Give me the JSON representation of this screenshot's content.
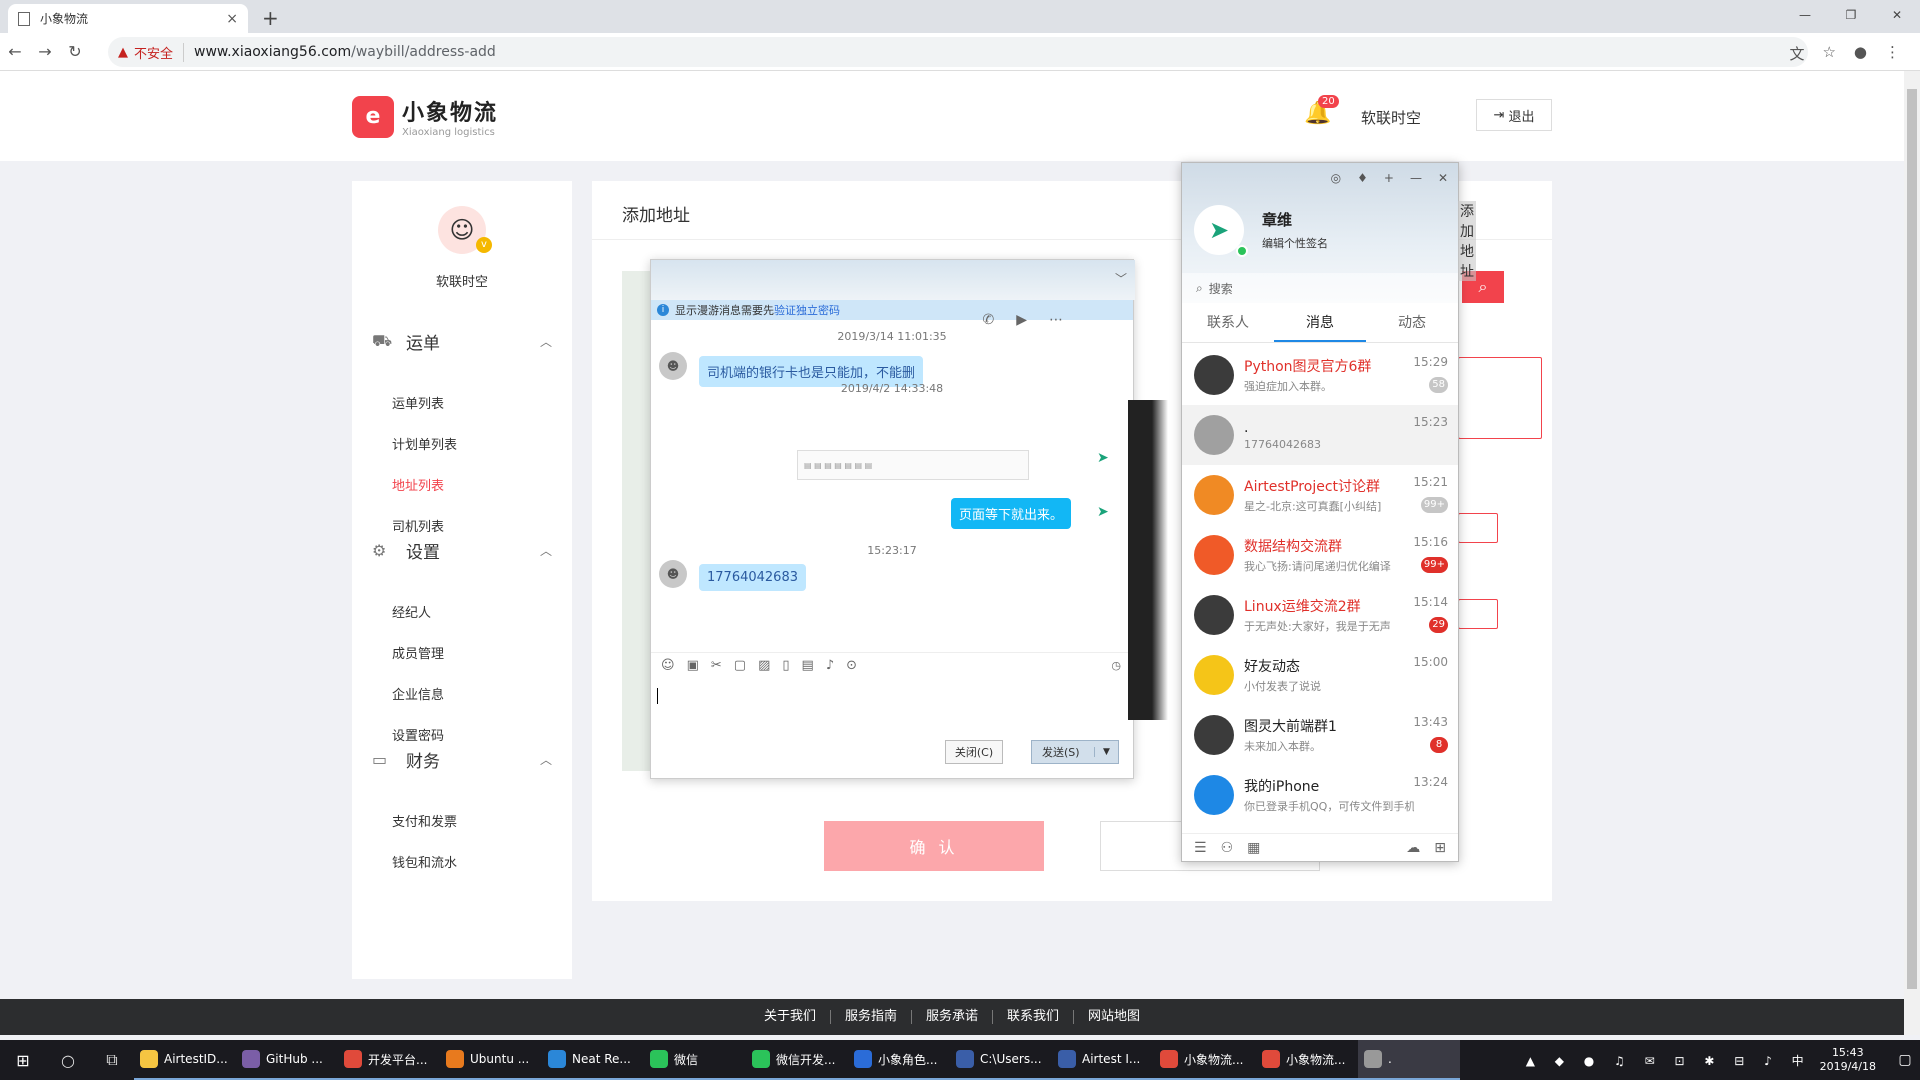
{
  "browser": {
    "tab_title": "小象物流",
    "tab_close": "×",
    "new_tab": "+",
    "insecure_label": "不安全",
    "url_host": "www.xiaoxiang56.com",
    "url_path": "/waybill/address-add"
  },
  "header": {
    "logo_cn": "小象物流",
    "logo_en": "Xiaoxiang logistics",
    "notify_count": "20",
    "user_name": "软联时空",
    "logout_label": "退出"
  },
  "sidebar": {
    "user_name": "软联时空",
    "sections": [
      {
        "title": "运单",
        "items": [
          "运单列表",
          "计划单列表",
          "地址列表",
          "司机列表"
        ]
      },
      {
        "title": "设置",
        "items": [
          "经纪人",
          "成员管理",
          "企业信息",
          "设置密码"
        ]
      },
      {
        "title": "财务",
        "items": [
          "支付和发票",
          "钱包和流水"
        ]
      }
    ],
    "active_item": "地址列表"
  },
  "main": {
    "title": "添加地址",
    "confirm_label": "确 认"
  },
  "chat": {
    "notice_text": "显示漫游消息需要先",
    "notice_link": "验证独立密码",
    "messages": [
      {
        "time": "2019/3/14 11:01:35",
        "text": "司机端的银行卡也是只能加，不能删",
        "dir": "in"
      },
      {
        "time": "2019/4/2 14:33:48",
        "text": "页面等下就出来。",
        "dir": "out"
      },
      {
        "time": "15:23:17",
        "text": "17764042683",
        "dir": "in"
      }
    ],
    "close_label": "关闭(C)",
    "send_label": "发送(S)"
  },
  "qq": {
    "name": "章维",
    "signature": "编辑个性签名",
    "overlay_text": "添加地址",
    "search_placeholder": "搜索",
    "tabs": [
      "联系人",
      "消息",
      "动态"
    ],
    "active_tab": "消息",
    "conversations": [
      {
        "name": "Python图灵官方6群",
        "sub": "强迫症加入本群。",
        "time": "15:29",
        "badge": "58",
        "red": true,
        "badge_color": "#c6c6c6",
        "avatar_color": "#3b3b3b"
      },
      {
        "name": ".",
        "sub": "17764042683",
        "time": "15:23",
        "badge": "",
        "red": false,
        "badge_color": "",
        "avatar_color": "#a0a0a0"
      },
      {
        "name": "AirtestProject讨论群",
        "sub": "星之-北京:这可真蠢[小纠结]",
        "time": "15:21",
        "badge": "99+",
        "red": true,
        "badge_color": "#c6c6c6",
        "avatar_color": "#f08a24"
      },
      {
        "name": "数据结构交流群",
        "sub": "我心飞扬:请问尾递归优化编译",
        "time": "15:16",
        "badge": "99+",
        "red": true,
        "badge_color": "#e0302a",
        "avatar_color": "#f05a28"
      },
      {
        "name": "Linux运维交流2群",
        "sub": "于无声处:大家好，我是于无声",
        "time": "15:14",
        "badge": "29",
        "red": true,
        "badge_color": "#e0302a",
        "avatar_color": "#3b3b3b"
      },
      {
        "name": "好友动态",
        "sub": "小付发表了说说",
        "time": "15:00",
        "badge": "",
        "red": false,
        "badge_color": "",
        "avatar_color": "#f5c518"
      },
      {
        "name": "图灵大前端群1",
        "sub": "未来加入本群。",
        "time": "13:43",
        "badge": "8",
        "red": false,
        "badge_color": "#e0302a",
        "avatar_color": "#3b3b3b"
      },
      {
        "name": "我的iPhone",
        "sub": "你已登录手机QQ，可传文件到手机",
        "time": "13:24",
        "badge": "",
        "red": false,
        "badge_color": "",
        "avatar_color": "#1e88e5"
      }
    ]
  },
  "footer": {
    "links": [
      "关于我们",
      "服务指南",
      "服务承诺",
      "联系我们",
      "网站地图"
    ]
  },
  "taskbar": {
    "apps": [
      {
        "label": "AirtestID...",
        "color": "#f5c542"
      },
      {
        "label": "GitHub ...",
        "color": "#7b5ea7"
      },
      {
        "label": "开发平台...",
        "color": "#e04a3b"
      },
      {
        "label": "Ubuntu ...",
        "color": "#e87a1e"
      },
      {
        "label": "Neat Re...",
        "color": "#2b87d8"
      },
      {
        "label": "微信",
        "color": "#2bc35a"
      },
      {
        "label": "微信开发...",
        "color": "#2bc35a"
      },
      {
        "label": "小象角色...",
        "color": "#2b6cd8"
      },
      {
        "label": "C:\\Users...",
        "color": "#3a5ea8"
      },
      {
        "label": "Airtest I...",
        "color": "#3a5ea8"
      },
      {
        "label": "小象物流...",
        "color": "#e04a3b"
      },
      {
        "label": "小象物流...",
        "color": "#e04a3b"
      },
      {
        "label": ".",
        "color": "#999999"
      }
    ],
    "time": "15:43",
    "date": "2019/4/18"
  }
}
